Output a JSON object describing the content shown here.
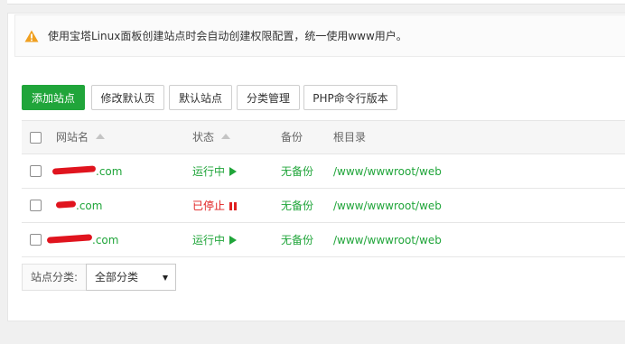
{
  "notice": {
    "text": "使用宝塔Linux面板创建站点时会自动创建权限配置，统一使用www用户。",
    "icon": "warning-icon",
    "icon_color": "#f0a020"
  },
  "toolbar": {
    "add_site": "添加站点",
    "edit_default_page": "修改默认页",
    "default_site": "默认站点",
    "category_manage": "分类管理",
    "php_cli_version": "PHP命令行版本"
  },
  "table": {
    "headers": {
      "site_name": "网站名",
      "status": "状态",
      "backup": "备份",
      "root": "根目录"
    },
    "rows": [
      {
        "name_suffix": ".com",
        "status": "运行中",
        "status_state": "running",
        "backup": "无备份",
        "root": "/www/wwwroot/web"
      },
      {
        "name_suffix": ".com",
        "status": "已停止",
        "status_state": "stopped",
        "backup": "无备份",
        "root": "/www/wwwroot/web"
      },
      {
        "name_suffix": ".com",
        "status": "运行中",
        "status_state": "running",
        "backup": "无备份",
        "root": "/www/wwwroot/web"
      }
    ]
  },
  "filter": {
    "label": "站点分类:",
    "selected": "全部分类"
  },
  "colors": {
    "accent": "#20a53a",
    "stopped": "#e02020",
    "redaction": "#e0141e"
  }
}
